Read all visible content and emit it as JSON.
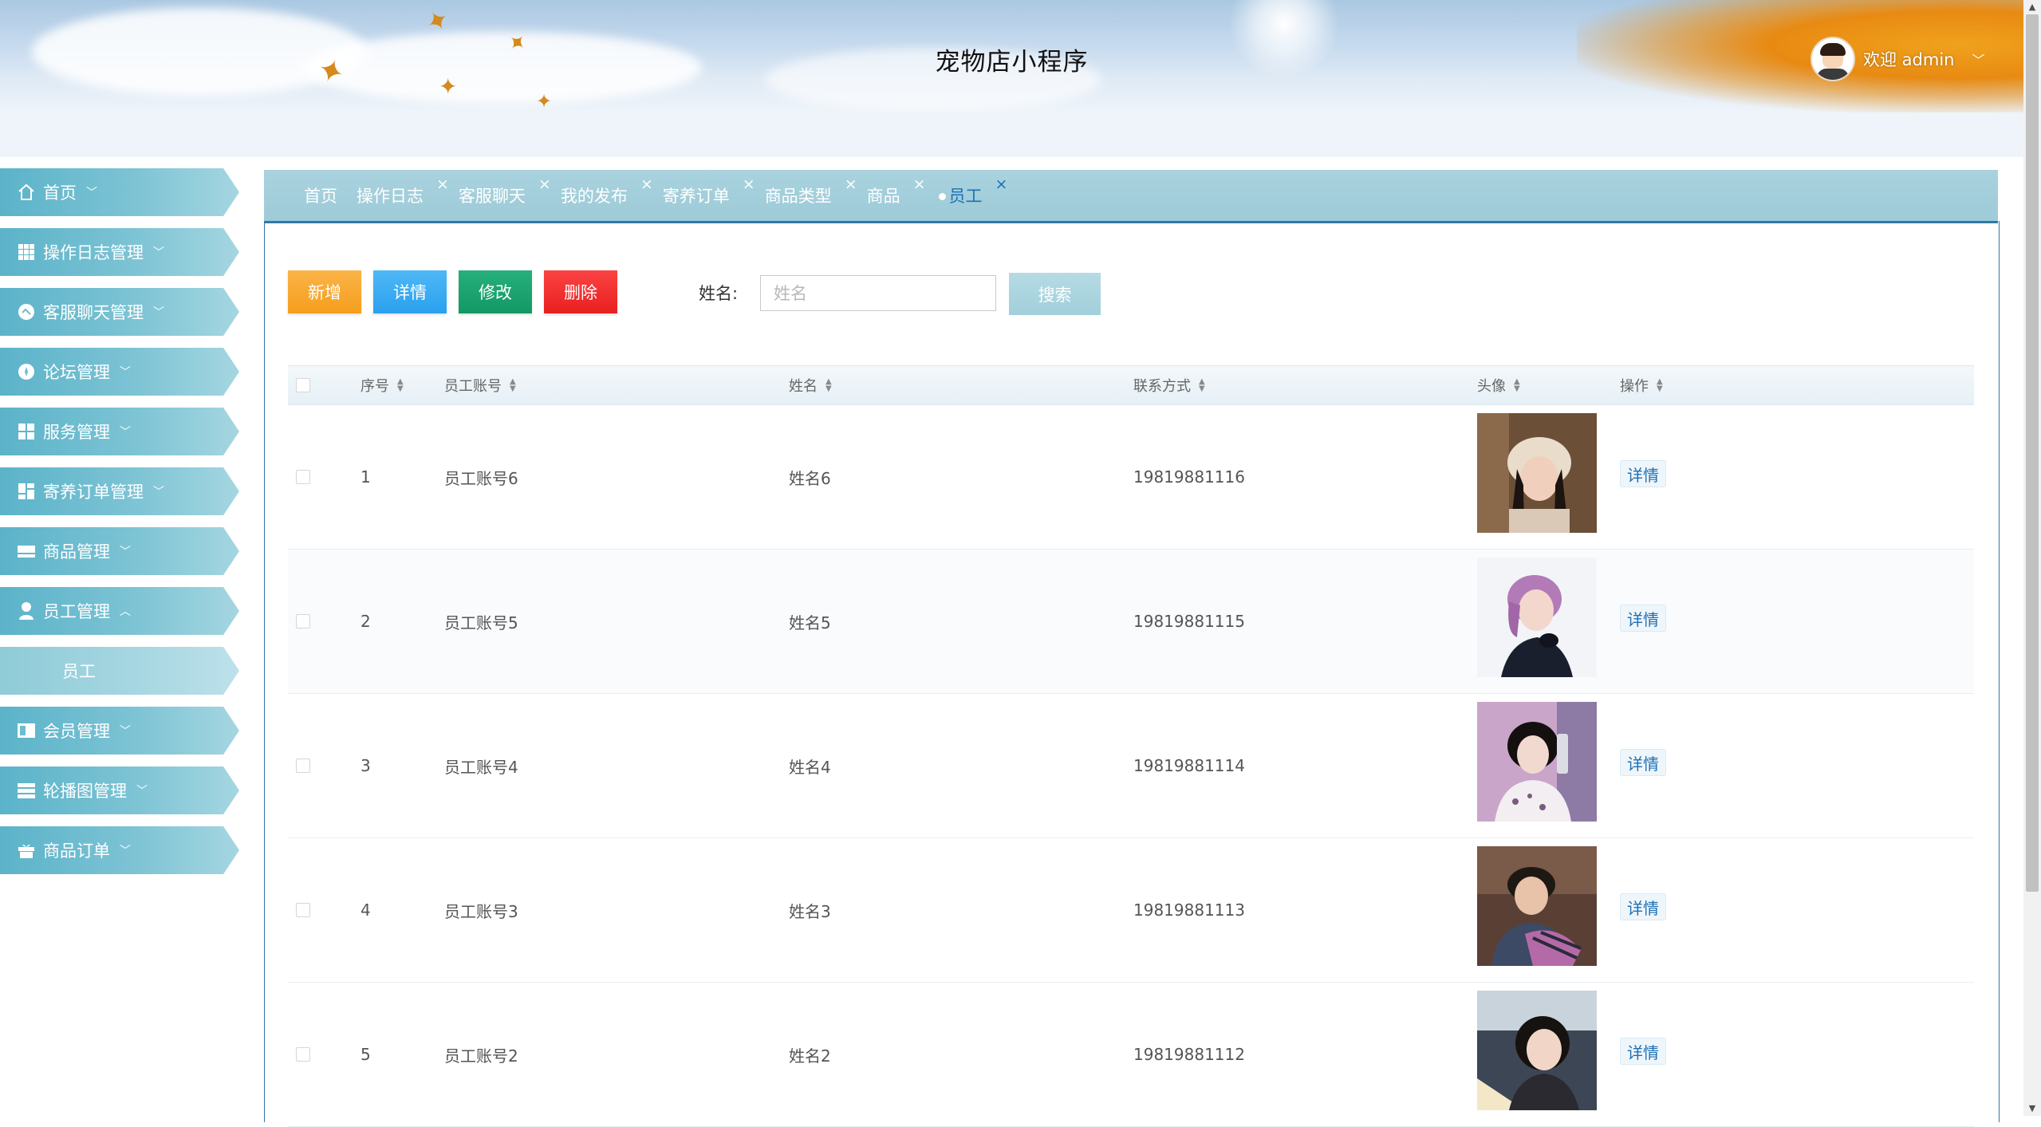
{
  "app": {
    "title": "宠物店小程序"
  },
  "user": {
    "welcome": "欢迎 admin"
  },
  "sidebar": {
    "items": [
      {
        "label": "首页",
        "icon": "home-icon"
      },
      {
        "label": "操作日志管理",
        "icon": "grid-icon"
      },
      {
        "label": "客服聊天管理",
        "icon": "chat-icon"
      },
      {
        "label": "论坛管理",
        "icon": "forum-icon"
      },
      {
        "label": "服务管理",
        "icon": "tiles-icon"
      },
      {
        "label": "寄养订单管理",
        "icon": "dashboard-icon"
      },
      {
        "label": "商品管理",
        "icon": "product-icon"
      },
      {
        "label": "员工管理",
        "icon": "user-icon",
        "expanded": true,
        "children": [
          "员工"
        ]
      },
      {
        "label": "会员管理",
        "icon": "member-icon"
      },
      {
        "label": "轮播图管理",
        "icon": "carousel-icon"
      },
      {
        "label": "商品订单",
        "icon": "gift-icon"
      }
    ]
  },
  "tabs": [
    {
      "label": "首页",
      "closable": false
    },
    {
      "label": "操作日志",
      "closable": true
    },
    {
      "label": "客服聊天",
      "closable": true
    },
    {
      "label": "我的发布",
      "closable": true
    },
    {
      "label": "寄养订单",
      "closable": true
    },
    {
      "label": "商品类型",
      "closable": true
    },
    {
      "label": "商品",
      "closable": true
    },
    {
      "label": "员工",
      "closable": true,
      "active": true
    }
  ],
  "toolbar": {
    "add": "新增",
    "detail": "详情",
    "edit": "修改",
    "delete": "删除",
    "search_label": "姓名:",
    "search_placeholder": "姓名",
    "search_value": "",
    "search_button": "搜索"
  },
  "table": {
    "columns": [
      "序号",
      "员工账号",
      "姓名",
      "联系方式",
      "头像",
      "操作"
    ],
    "rows": [
      {
        "index": "1",
        "account": "员工账号6",
        "name": "姓名6",
        "phone": "19819881116",
        "action": "详情"
      },
      {
        "index": "2",
        "account": "员工账号5",
        "name": "姓名5",
        "phone": "19819881115",
        "action": "详情"
      },
      {
        "index": "3",
        "account": "员工账号4",
        "name": "姓名4",
        "phone": "19819881114",
        "action": "详情"
      },
      {
        "index": "4",
        "account": "员工账号3",
        "name": "姓名3",
        "phone": "19819881113",
        "action": "详情"
      },
      {
        "index": "5",
        "account": "员工账号2",
        "name": "姓名2",
        "phone": "19819881112",
        "action": "详情"
      }
    ]
  },
  "colors": {
    "menu": "#6fbccf",
    "tabs_bar": "#a4cfdb",
    "accent_blue": "#1e70b4",
    "btn_add": "#f7a52b",
    "btn_detail": "#36a9f2",
    "btn_edit": "#1aa16d",
    "btn_delete": "#f02d2d"
  }
}
